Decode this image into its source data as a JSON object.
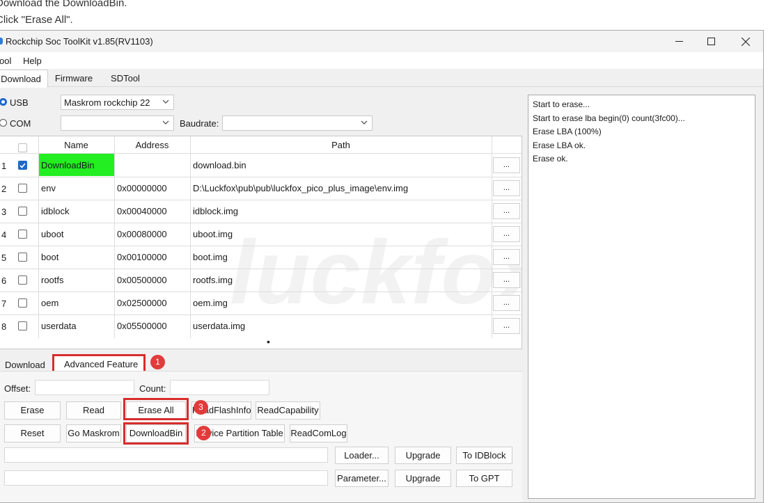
{
  "instructions": [
    "Download the DownloadBin.",
    "Click \"Erase All\"."
  ],
  "window": {
    "title": "Rockchip Soc ToolKit v1.85(RV1103)",
    "controls": [
      "minimize-icon",
      "maximize-icon",
      "close-icon"
    ]
  },
  "menu": [
    "ool",
    "Help"
  ],
  "tabs": [
    {
      "label": "Download",
      "active": true
    },
    {
      "label": "Firmware",
      "active": false
    },
    {
      "label": "SDTool",
      "active": false
    }
  ],
  "connection": {
    "usb_label": "USB",
    "usb_selected": true,
    "usb_device": "Maskrom rockchip 22",
    "com_label": "COM",
    "com_value": "",
    "baudrate_label": "Baudrate:",
    "baudrate_value": ""
  },
  "table": {
    "columns": [
      "Name",
      "Address",
      "Path"
    ],
    "browse_label": "...",
    "rows": [
      {
        "index": "1",
        "checked": true,
        "name": "DownloadBin",
        "address": "",
        "path": "download.bin",
        "highlight": "#22ee22"
      },
      {
        "index": "2",
        "checked": false,
        "name": "env",
        "address": "0x00000000",
        "path": "D:\\Luckfox\\pub\\pub\\luckfox_pico_plus_image\\env.img"
      },
      {
        "index": "3",
        "checked": false,
        "name": "idblock",
        "address": "0x00040000",
        "path": "idblock.img"
      },
      {
        "index": "4",
        "checked": false,
        "name": "uboot",
        "address": "0x00080000",
        "path": "uboot.img"
      },
      {
        "index": "5",
        "checked": false,
        "name": "boot",
        "address": "0x00100000",
        "path": "boot.img"
      },
      {
        "index": "6",
        "checked": false,
        "name": "rootfs",
        "address": "0x00500000",
        "path": "rootfs.img"
      },
      {
        "index": "7",
        "checked": false,
        "name": "oem",
        "address": "0x02500000",
        "path": "oem.img"
      },
      {
        "index": "8",
        "checked": false,
        "name": "userdata",
        "address": "0x05500000",
        "path": "userdata.img"
      }
    ],
    "pager_glyph": "•"
  },
  "subtabs": [
    {
      "label": "Download",
      "active": false
    },
    {
      "label": "Advanced Feature",
      "active": true
    }
  ],
  "advanced": {
    "offset_label": "Offset:",
    "offset_value": "",
    "count_label": "Count:",
    "count_value": "",
    "row1": [
      "Erase",
      "Read",
      "Erase All",
      "ReadFlashInfo",
      "ReadCapability"
    ],
    "row2": [
      "Reset",
      "Go Maskrom",
      "DownloadBin",
      "Device Partition Table",
      "ReadComLog"
    ],
    "loader_label": "Loader...",
    "parameter_label": "Parameter...",
    "upgrade_label": "Upgrade",
    "to_idblock_label": "To IDBlock",
    "to_gpt_label": "To GPT"
  },
  "log": [
    "Start to erase...",
    "Start to erase lba begin(0) count(3fc00)...",
    "Erase LBA (100%)",
    "Erase LBA ok.",
    "Erase ok."
  ],
  "markers": [
    "1",
    "2",
    "3"
  ],
  "colors": {
    "accent": "#1e68c8",
    "callout": "#d82c2c",
    "highlight": "#22ee22"
  }
}
